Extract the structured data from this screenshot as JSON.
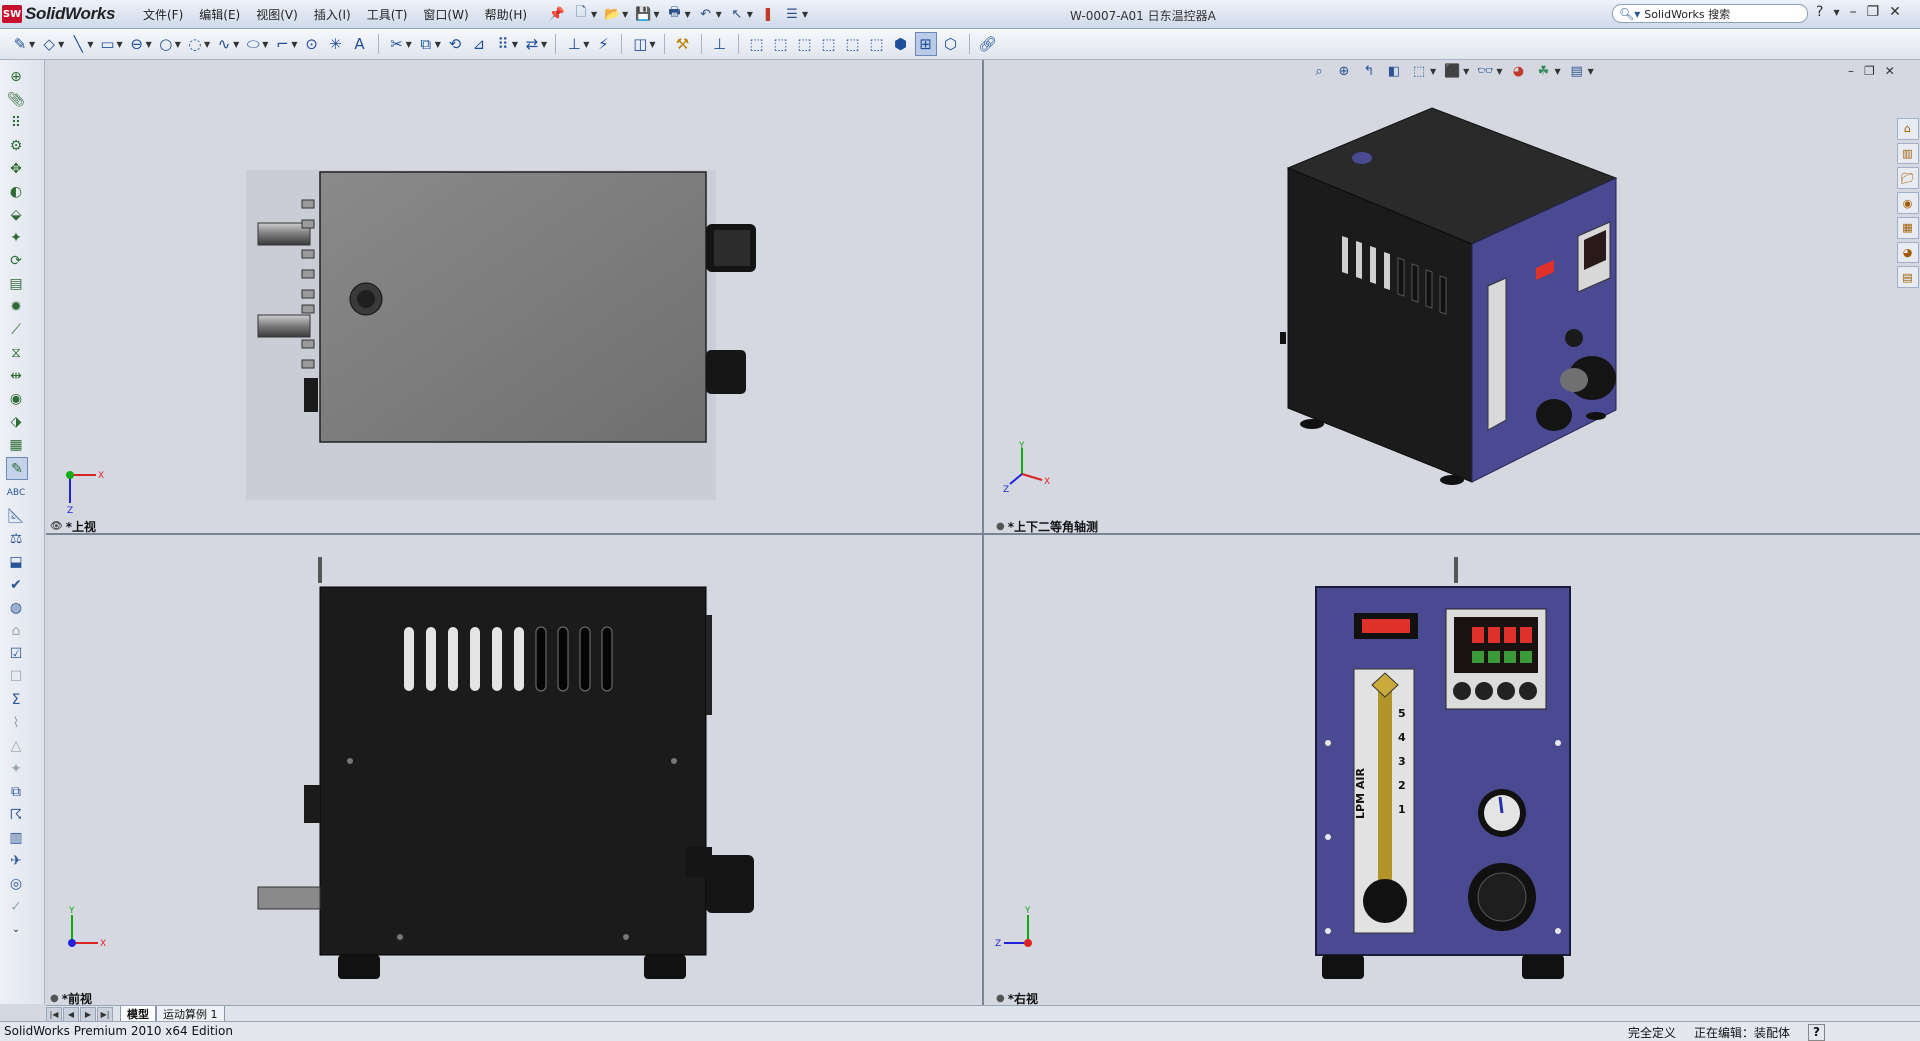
{
  "app": {
    "name": "SolidWorks",
    "logo_mark": "SW"
  },
  "menu": [
    "文件(F)",
    "编辑(E)",
    "视图(V)",
    "插入(I)",
    "工具(T)",
    "窗口(W)",
    "帮助(H)"
  ],
  "document_title": "W-0007-A01 日东温控器A",
  "search": {
    "placeholder": "SolidWorks 搜索"
  },
  "viewports": {
    "top_view": "*上视",
    "iso_view": "*上下二等角轴测",
    "front_view": "*前视",
    "right_view": "*右视"
  },
  "triad_labels": {
    "x": "X",
    "y": "Y",
    "z": "Z"
  },
  "model": {
    "flowmeter_label": "LPM AIR",
    "flowmeter_scale": [
      "5",
      "4",
      "3",
      "2",
      "1"
    ]
  },
  "tabs": [
    "模型",
    "运动算例 1"
  ],
  "status": {
    "edition": "SolidWorks Premium 2010 x64 Edition",
    "definition": "完全定义",
    "editing": "正在编辑：装配体",
    "help": "?"
  },
  "colors": {
    "housing": "#1b1b1b",
    "top_panel": "#7d7d7d",
    "front_panel": "#4a4a93",
    "display_red": "#e0302a"
  }
}
